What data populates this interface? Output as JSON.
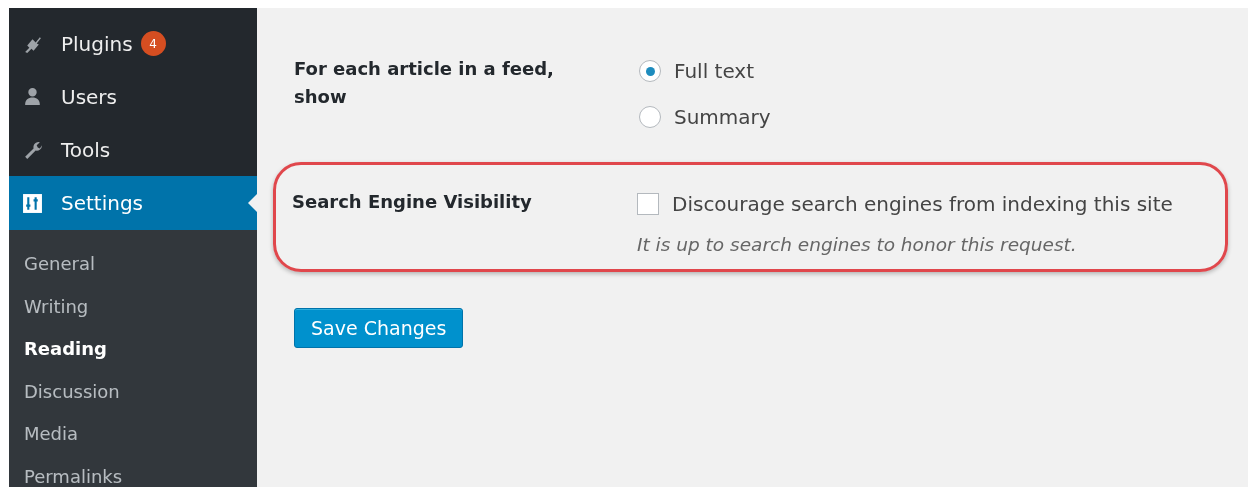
{
  "sidebar": {
    "items": [
      {
        "label": "Plugins",
        "kind": "plug",
        "badge": "4",
        "selected": false
      },
      {
        "label": "Users",
        "kind": "user",
        "selected": false
      },
      {
        "label": "Tools",
        "kind": "wrench",
        "selected": false
      },
      {
        "label": "Settings",
        "kind": "sliders",
        "selected": true
      }
    ],
    "submenu": [
      {
        "label": "General",
        "selected": false
      },
      {
        "label": "Writing",
        "selected": false
      },
      {
        "label": "Reading",
        "selected": true
      },
      {
        "label": "Discussion",
        "selected": false
      },
      {
        "label": "Media",
        "selected": false
      },
      {
        "label": "Permalinks",
        "selected": false
      }
    ]
  },
  "settings": [
    {
      "kind": "radio",
      "label": "For each article in a feed, show",
      "highlighted": false,
      "options": [
        {
          "label": "Full text",
          "selected": true
        },
        {
          "label": "Summary",
          "selected": false
        }
      ]
    },
    {
      "kind": "checkbox",
      "label": "Search Engine Visibility",
      "highlighted": true,
      "option": "Discourage search engines from indexing this site",
      "checked": false,
      "description": "It is up to search engines to honor this request."
    }
  ],
  "save_button": "Save Changes"
}
